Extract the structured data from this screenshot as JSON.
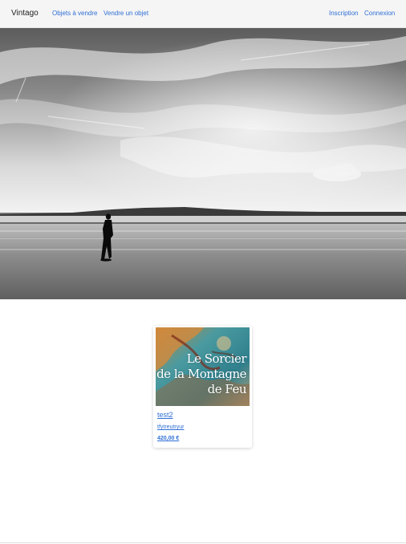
{
  "navbar": {
    "brand": "Vintago",
    "links_left": [
      "Objets à vendre",
      "Vendre un objet"
    ],
    "links_right": [
      "Inscription",
      "Connexion"
    ],
    "link_color": "#2f6fd6"
  },
  "listing": {
    "title": "test2",
    "description": "tfytreutryur",
    "price": "420,00 €",
    "cover_text": [
      "Le Sorcier",
      "de la Montagne",
      "de Feu"
    ]
  }
}
